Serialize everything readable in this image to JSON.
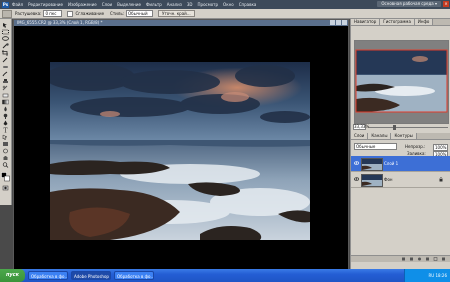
{
  "app": {
    "logo": "Ps",
    "menus": [
      "Файл",
      "Редактирование",
      "Изображение",
      "Слои",
      "Выделение",
      "Фильтр",
      "Анализ",
      "3D",
      "Просмотр",
      "Окно",
      "Справка"
    ],
    "workspace": "Основная рабочая среда ▾"
  },
  "options": {
    "feather_label": "Растушевка:",
    "feather_value": "0 пкс",
    "antialias_label": "Сглаживание",
    "style_label": "Стиль:",
    "style_value": "Обычный",
    "refine_button": "Уточн. край..."
  },
  "document": {
    "title": "IMG_6555.CR2 @ 33,3% (Слой 1, RGB/8) *"
  },
  "navigator": {
    "tabs": [
      "Навигатор",
      "Гистограмма",
      "Инфо"
    ],
    "zoom": "33,33%"
  },
  "layers_panel": {
    "tabs": [
      "Слои",
      "Каналы",
      "Контуры"
    ],
    "blend_mode": "Обычные",
    "opacity_label": "Непрозр.:",
    "opacity_value": "100%",
    "fill_label": "Заливка:",
    "fill_value": "100%",
    "layers": [
      {
        "name": "Слой 1",
        "selected": true
      },
      {
        "name": "Фон",
        "selected": false
      }
    ]
  },
  "taskbar": {
    "start": "пуск",
    "tasks": [
      "Обработка в фо...",
      "Adobe Photoshop CS...",
      "Обработка в фо..."
    ],
    "clock": "RU 18:26"
  },
  "colors": {
    "accent_selected_layer": "#3d6fd6",
    "document_bg": "#000000",
    "taskbar": "#245ed4"
  }
}
